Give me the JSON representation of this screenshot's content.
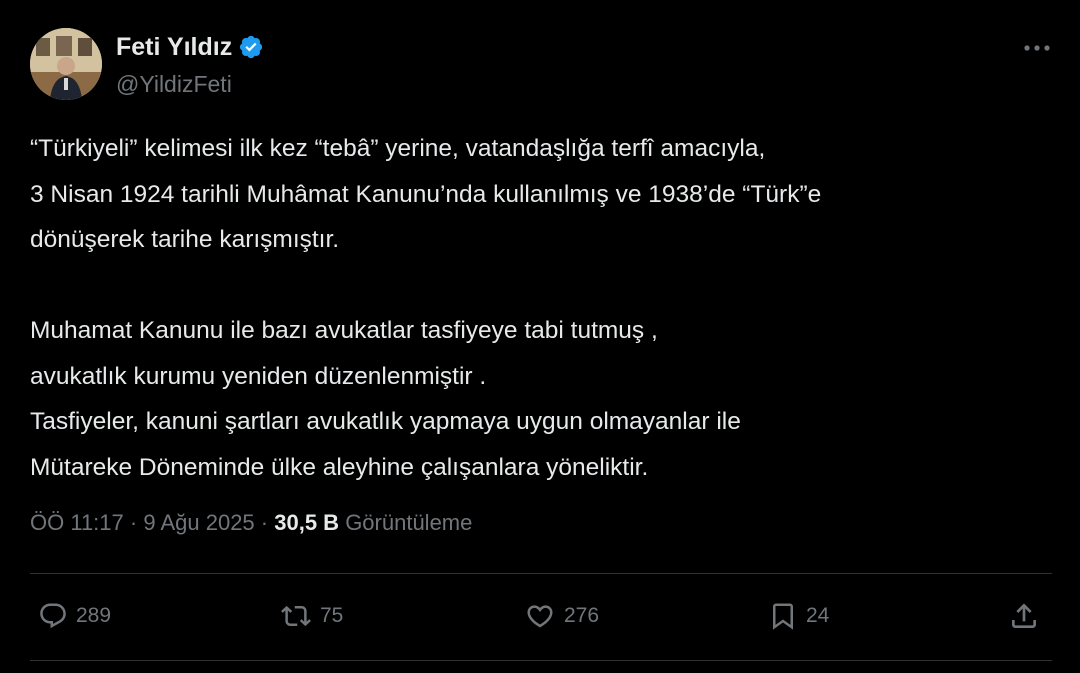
{
  "author": {
    "display_name": "Feti Yıldız",
    "handle": "@YildizFeti",
    "verified": true,
    "avatar_icon": "profile-photo"
  },
  "tweet": {
    "paragraphs": [
      "“Türkiyeli” kelimesi ilk kez “tebâ” yerine, vatandaşlığa terfî amacıyla,\n3 Nisan 1924 tarihli Muhâmat Kanunu’nda kullanılmış ve 1938’de “Türk”e\ndönüşerek tarihe karışmıştır.",
      "Muhamat Kanunu ile bazı avukatlar tasfiyeye tabi tutmuş ,\navukatlık kurumu yeniden düzenlenmiştir .\nTasfiyeler, kanuni şartları avukatlık yapmaya uygun olmayanlar ile\nMütareke Döneminde ülke aleyhine çalışanlara yöneliktir."
    ]
  },
  "meta": {
    "time": "ÖÖ 11:17",
    "separator": " · ",
    "date": "9 Ağu 2025",
    "views_count": "30,5 B",
    "views_label": "Görüntüleme"
  },
  "actions": {
    "replies": "289",
    "retweets": "75",
    "likes": "276",
    "bookmarks": "24"
  },
  "icons": {
    "reply": "reply-icon",
    "retweet": "retweet-icon",
    "like": "heart-icon",
    "bookmark": "bookmark-icon",
    "share": "share-icon",
    "more": "more-icon",
    "verified": "verified-badge-icon"
  },
  "colors": {
    "background": "#000000",
    "text": "#e7e9ea",
    "secondary": "#71767b",
    "divider": "#2f3336",
    "verified": "#1d9bf0"
  }
}
